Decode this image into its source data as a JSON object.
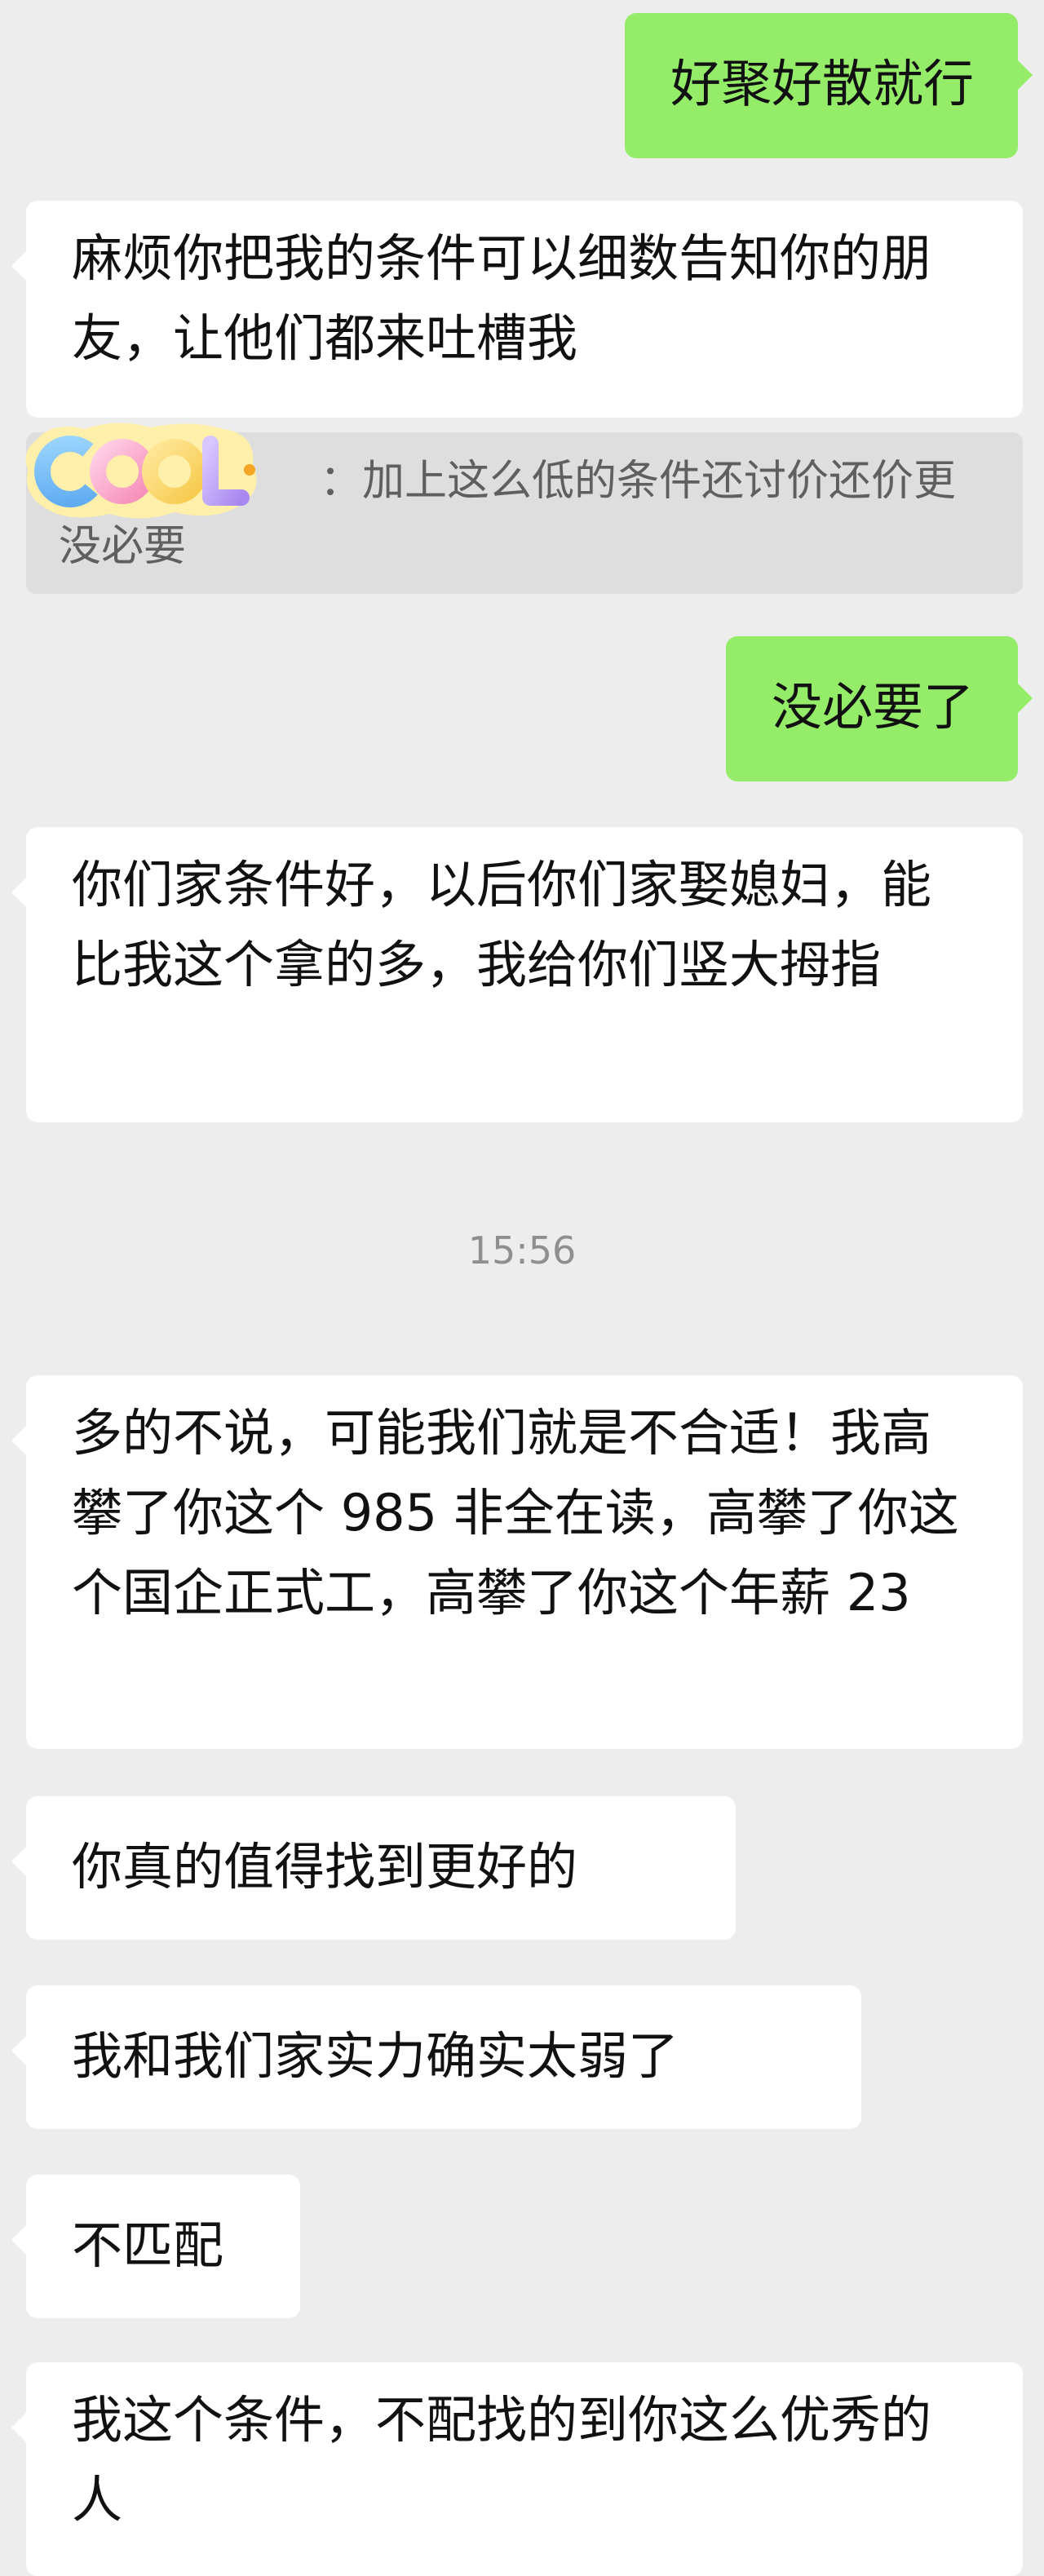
{
  "messages": [
    {
      "id": "m1",
      "side": "right",
      "text": "好聚好散就行"
    },
    {
      "id": "m2",
      "side": "left",
      "text": "麻烦你把我的条件可以细数告知你的朋友，让他们都来吐槽我"
    },
    {
      "id": "m3",
      "side": "right",
      "text": "没必要了"
    },
    {
      "id": "m4",
      "side": "left",
      "text": "你们家条件好，以后你们家娶媳妇，能比我这个拿的多，我给你们竖大拇指"
    },
    {
      "id": "m5",
      "side": "left",
      "text": "多的不说，可能我们就是不合适！我高攀了你这个 985 非全在读，高攀了你这个国企正式工，高攀了你这个年薪 23"
    },
    {
      "id": "m6",
      "side": "left",
      "text": "你真的值得找到更好的"
    },
    {
      "id": "m7",
      "side": "left",
      "text": "我和我们家实力确实太弱了"
    },
    {
      "id": "m8",
      "side": "left",
      "text": "不匹配"
    },
    {
      "id": "m9",
      "side": "left",
      "text": "我这个条件，不配找的到你这么优秀的人"
    }
  ],
  "quote": {
    "sticker_text": "COOL",
    "text": "：加上这么低的条件还讨价还价更没必要"
  },
  "timestamp": "15:56",
  "colors": {
    "background": "#ededed",
    "self_bubble": "#95ec69",
    "other_bubble": "#ffffff",
    "quote_bg": "#dedede"
  }
}
